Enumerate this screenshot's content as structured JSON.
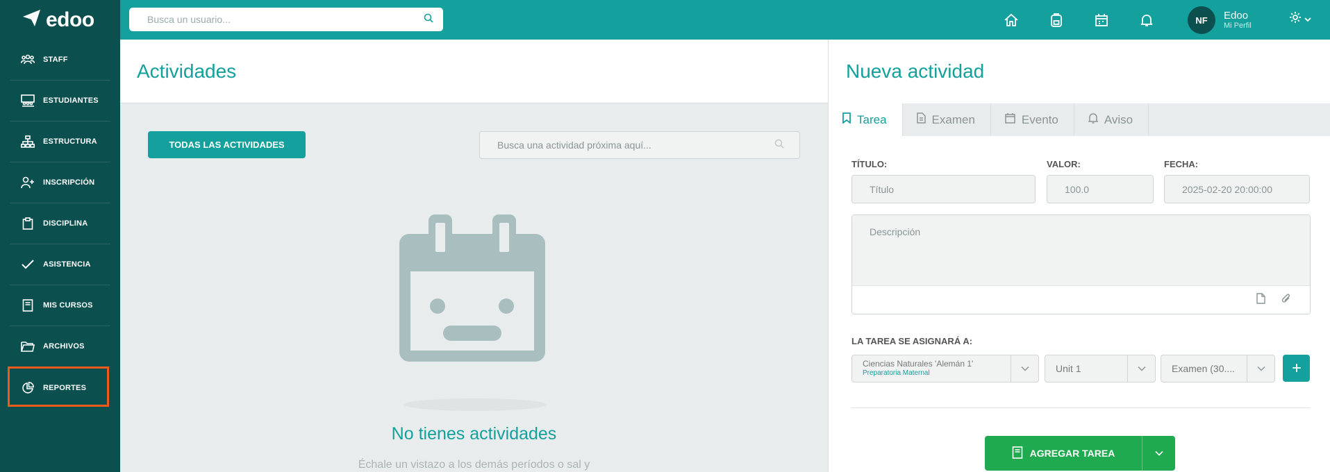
{
  "app": {
    "logo_text": "edoo"
  },
  "sidebar": {
    "items": [
      {
        "label": "STAFF",
        "icon": "staff-icon"
      },
      {
        "label": "ESTUDIANTES",
        "icon": "students-icon"
      },
      {
        "label": "ESTRUCTURA",
        "icon": "structure-icon"
      },
      {
        "label": "INSCRIPCIÓN",
        "icon": "add-user-icon"
      },
      {
        "label": "DISCIPLINA",
        "icon": "clipboard-icon"
      },
      {
        "label": "ASISTENCIA",
        "icon": "check-icon"
      },
      {
        "label": "MIS CURSOS",
        "icon": "book-icon"
      },
      {
        "label": "ARCHIVOS",
        "icon": "folder-icon"
      },
      {
        "label": "REPORTES",
        "icon": "pie-chart-icon"
      }
    ],
    "highlight_color": "#f05a1a"
  },
  "header": {
    "search_placeholder": "Busca un usuario...",
    "icons": [
      "home-icon",
      "backpack-icon",
      "calendar-icon",
      "bell-icon"
    ],
    "user": {
      "initials": "NF",
      "name": "Edoo",
      "subtitle": "Mi Perfil"
    },
    "accent_color": "#14a09c"
  },
  "activities": {
    "title": "Actividades",
    "all_button": "TODAS LAS ACTIVIDADES",
    "search_placeholder": "Busca una actividad próxima aquí...",
    "empty_title": "No tienes actividades",
    "empty_subtitle": "Échale un vistazo a los demás períodos o sal y"
  },
  "new_activity": {
    "title": "Nueva actividad",
    "tabs": [
      {
        "label": "Tarea",
        "icon": "bookmark-icon",
        "active": true
      },
      {
        "label": "Examen",
        "icon": "document-icon",
        "active": false
      },
      {
        "label": "Evento",
        "icon": "calendar-icon",
        "active": false
      },
      {
        "label": "Aviso",
        "icon": "bell-icon",
        "active": false
      }
    ],
    "fields": {
      "title_label": "TÍTULO:",
      "title_placeholder": "Título",
      "value_label": "VALOR:",
      "value": "100.0",
      "date_label": "FECHA:",
      "date": "2025-02-20 20:00:00",
      "description_placeholder": "Descripción"
    },
    "assign_label": "LA TAREA SE ASIGNARÁ A:",
    "course_select": {
      "value": "Ciencias Naturales 'Alemán 1'",
      "sub": "Preparatoria Maternal"
    },
    "unit_select": {
      "value": "Unit 1"
    },
    "type_select": {
      "value": "Examen (30...."
    },
    "submit_label": "AGREGAR TAREA",
    "submit_color": "#1faa4f"
  }
}
